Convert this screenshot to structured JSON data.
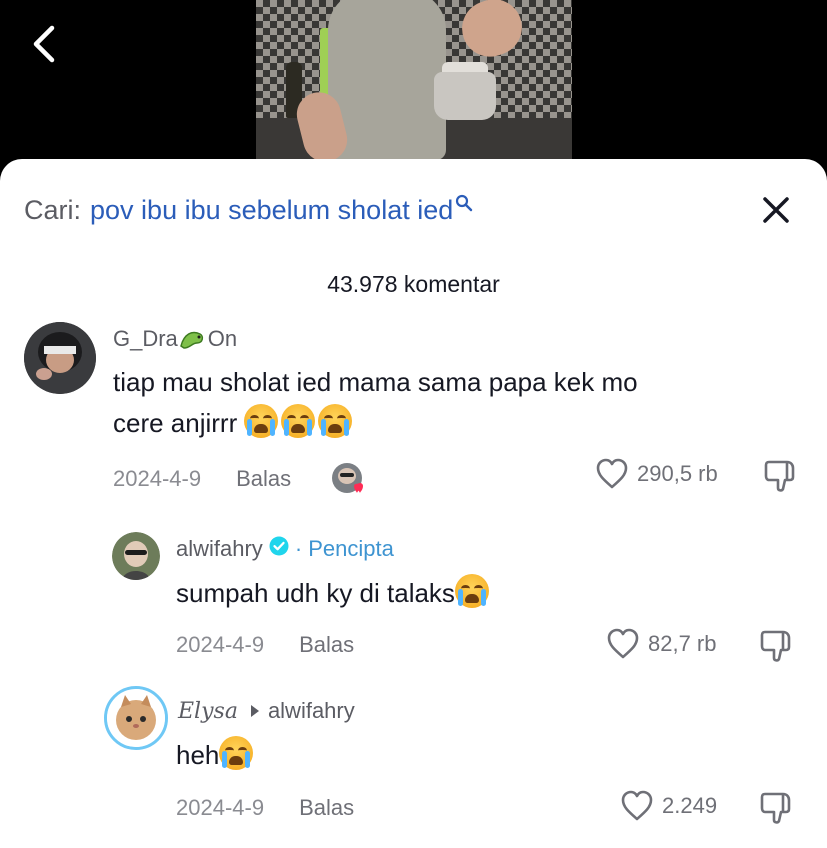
{
  "search": {
    "prefix": "Cari:",
    "query": "pov ibu ibu sebelum sholat ied"
  },
  "comment_count": "43.978 komentar",
  "comments": [
    {
      "username_part1": "G_Dra",
      "username_part2": "On",
      "text_line1": "tiap mau sholat ied mama sama papa kek mo",
      "text_line2": "cere anjirrr",
      "date": "2024-4-9",
      "reply_label": "Balas",
      "likes": "290,5 rb"
    },
    {
      "username": "alwifahry",
      "creator_label": "· Pencipta",
      "text": "sumpah udh ky di talaks",
      "date": "2024-4-9",
      "reply_label": "Balas",
      "likes": "82,7 rb"
    },
    {
      "username": "Elysa",
      "reply_to": "alwifahry",
      "text": "heh",
      "date": "2024-4-9",
      "reply_label": "Balas",
      "likes": "2.249"
    }
  ],
  "colors": {
    "link": "#2b5db9",
    "creator": "#3e94d1",
    "secondary": "#8a8b91",
    "text": "#161823"
  },
  "icons": [
    "back-arrow-icon",
    "search-icon",
    "close-icon",
    "heart-icon",
    "dislike-icon",
    "crying-emoji-icon",
    "verified-icon"
  ]
}
